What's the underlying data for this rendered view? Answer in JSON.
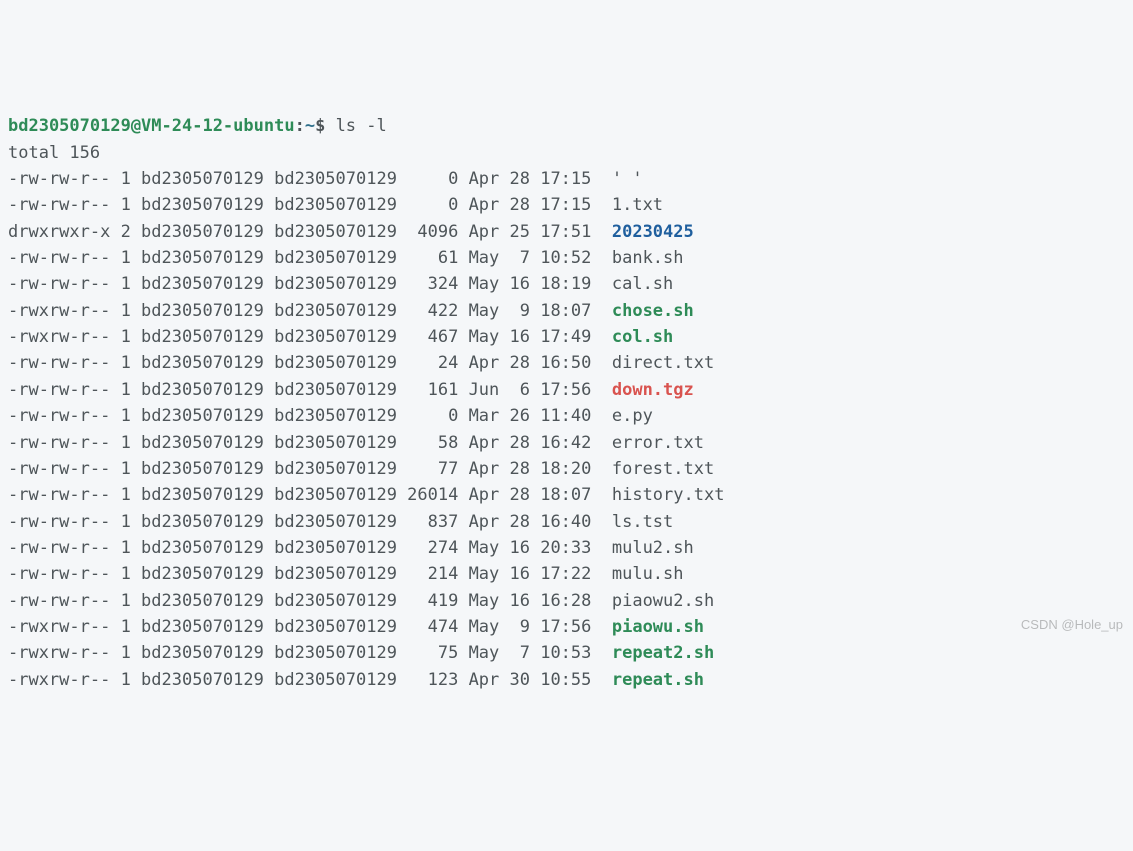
{
  "prompt": {
    "user_host": "bd2305070129@VM-24-12-ubuntu",
    "separator": ":",
    "path": "~",
    "dollar": "$",
    "command": "ls -l"
  },
  "total_line": "total 156",
  "columns_spec": {
    "perms_w": 11,
    "links_w": 1,
    "owner_w": 13,
    "group_w": 12,
    "size_w": 5,
    "month_w": 3,
    "day_w": 2,
    "time_w": 5
  },
  "entries": [
    {
      "perms": "-rw-rw-r--",
      "links": 1,
      "owner": "bd2305070129",
      "group": "bd2305070129",
      "size": 0,
      "month": "Apr",
      "day": 28,
      "time": "17:15",
      "name": "' '",
      "kind": "reg"
    },
    {
      "perms": "-rw-rw-r--",
      "links": 1,
      "owner": "bd2305070129",
      "group": "bd2305070129",
      "size": 0,
      "month": "Apr",
      "day": 28,
      "time": "17:15",
      "name": "1.txt",
      "kind": "reg"
    },
    {
      "perms": "drwxrwxr-x",
      "links": 2,
      "owner": "bd2305070129",
      "group": "bd2305070129",
      "size": 4096,
      "month": "Apr",
      "day": 25,
      "time": "17:51",
      "name": "20230425",
      "kind": "dir"
    },
    {
      "perms": "-rw-rw-r--",
      "links": 1,
      "owner": "bd2305070129",
      "group": "bd2305070129",
      "size": 61,
      "month": "May",
      "day": 7,
      "time": "10:52",
      "name": "bank.sh",
      "kind": "reg"
    },
    {
      "perms": "-rw-rw-r--",
      "links": 1,
      "owner": "bd2305070129",
      "group": "bd2305070129",
      "size": 324,
      "month": "May",
      "day": 16,
      "time": "18:19",
      "name": "cal.sh",
      "kind": "reg"
    },
    {
      "perms": "-rwxrw-r--",
      "links": 1,
      "owner": "bd2305070129",
      "group": "bd2305070129",
      "size": 422,
      "month": "May",
      "day": 9,
      "time": "18:07",
      "name": "chose.sh",
      "kind": "exec"
    },
    {
      "perms": "-rwxrw-r--",
      "links": 1,
      "owner": "bd2305070129",
      "group": "bd2305070129",
      "size": 467,
      "month": "May",
      "day": 16,
      "time": "17:49",
      "name": "col.sh",
      "kind": "exec"
    },
    {
      "perms": "-rw-rw-r--",
      "links": 1,
      "owner": "bd2305070129",
      "group": "bd2305070129",
      "size": 24,
      "month": "Apr",
      "day": 28,
      "time": "16:50",
      "name": "direct.txt",
      "kind": "reg"
    },
    {
      "perms": "-rw-rw-r--",
      "links": 1,
      "owner": "bd2305070129",
      "group": "bd2305070129",
      "size": 161,
      "month": "Jun",
      "day": 6,
      "time": "17:56",
      "name": "down.tgz",
      "kind": "arch"
    },
    {
      "perms": "-rw-rw-r--",
      "links": 1,
      "owner": "bd2305070129",
      "group": "bd2305070129",
      "size": 0,
      "month": "Mar",
      "day": 26,
      "time": "11:40",
      "name": "e.py",
      "kind": "reg"
    },
    {
      "perms": "-rw-rw-r--",
      "links": 1,
      "owner": "bd2305070129",
      "group": "bd2305070129",
      "size": 58,
      "month": "Apr",
      "day": 28,
      "time": "16:42",
      "name": "error.txt",
      "kind": "reg"
    },
    {
      "perms": "-rw-rw-r--",
      "links": 1,
      "owner": "bd2305070129",
      "group": "bd2305070129",
      "size": 77,
      "month": "Apr",
      "day": 28,
      "time": "18:20",
      "name": "forest.txt",
      "kind": "reg"
    },
    {
      "perms": "-rw-rw-r--",
      "links": 1,
      "owner": "bd2305070129",
      "group": "bd2305070129",
      "size": 26014,
      "month": "Apr",
      "day": 28,
      "time": "18:07",
      "name": "history.txt",
      "kind": "reg"
    },
    {
      "perms": "-rw-rw-r--",
      "links": 1,
      "owner": "bd2305070129",
      "group": "bd2305070129",
      "size": 837,
      "month": "Apr",
      "day": 28,
      "time": "16:40",
      "name": "ls.tst",
      "kind": "reg"
    },
    {
      "perms": "-rw-rw-r--",
      "links": 1,
      "owner": "bd2305070129",
      "group": "bd2305070129",
      "size": 274,
      "month": "May",
      "day": 16,
      "time": "20:33",
      "name": "mulu2.sh",
      "kind": "reg"
    },
    {
      "perms": "-rw-rw-r--",
      "links": 1,
      "owner": "bd2305070129",
      "group": "bd2305070129",
      "size": 214,
      "month": "May",
      "day": 16,
      "time": "17:22",
      "name": "mulu.sh",
      "kind": "reg"
    },
    {
      "perms": "-rw-rw-r--",
      "links": 1,
      "owner": "bd2305070129",
      "group": "bd2305070129",
      "size": 419,
      "month": "May",
      "day": 16,
      "time": "16:28",
      "name": "piaowu2.sh",
      "kind": "reg"
    },
    {
      "perms": "-rwxrw-r--",
      "links": 1,
      "owner": "bd2305070129",
      "group": "bd2305070129",
      "size": 474,
      "month": "May",
      "day": 9,
      "time": "17:56",
      "name": "piaowu.sh",
      "kind": "exec"
    },
    {
      "perms": "-rwxrw-r--",
      "links": 1,
      "owner": "bd2305070129",
      "group": "bd2305070129",
      "size": 75,
      "month": "May",
      "day": 7,
      "time": "10:53",
      "name": "repeat2.sh",
      "kind": "exec"
    },
    {
      "perms": "-rwxrw-r--",
      "links": 1,
      "owner": "bd2305070129",
      "group": "bd2305070129",
      "size": 123,
      "month": "Apr",
      "day": 30,
      "time": "10:55",
      "name": "repeat.sh",
      "kind": "exec"
    }
  ],
  "watermark": "CSDN @Hole_up"
}
